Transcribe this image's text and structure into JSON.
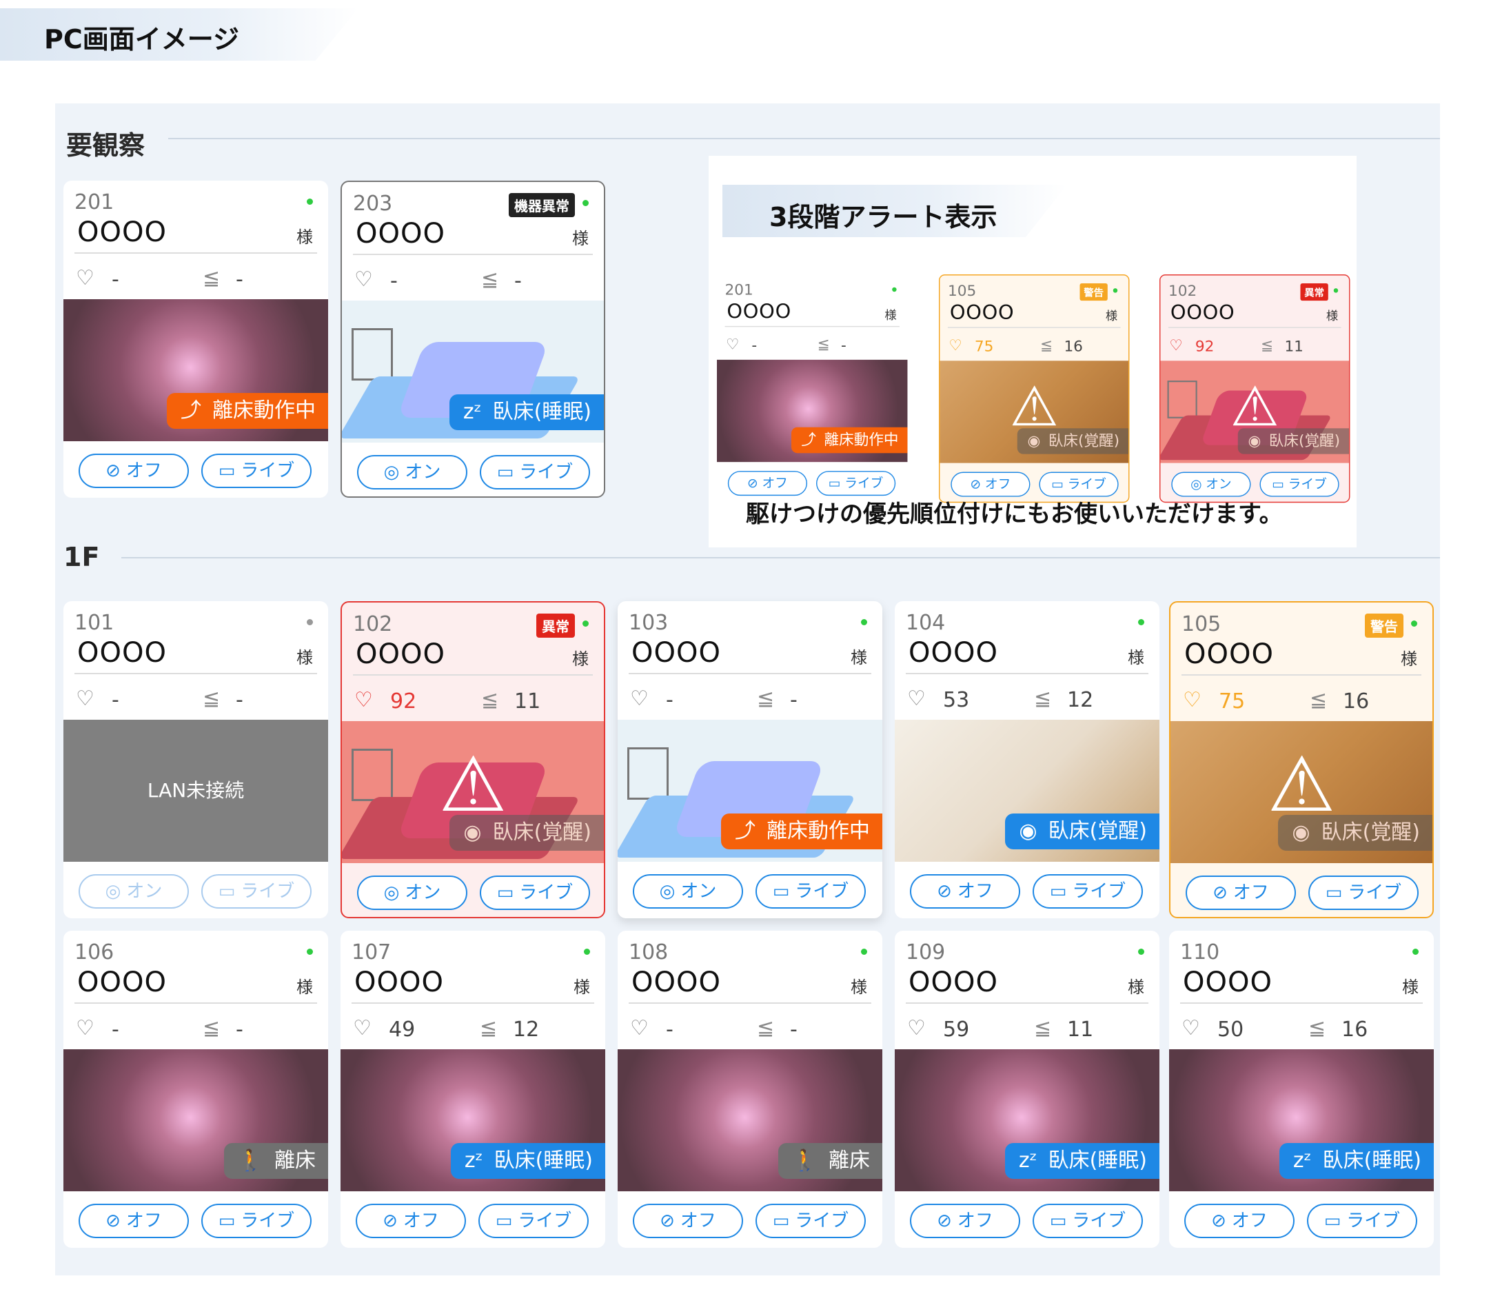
{
  "header": {
    "title": "PC画面イメージ"
  },
  "sections": {
    "watch": "要観察",
    "floor": "1F"
  },
  "common": {
    "sama": "様",
    "on": "オン",
    "off": "オフ",
    "live": "ライブ"
  },
  "inset": {
    "title": "3段階アラート表示",
    "footer": "駆けつけの優先順位付けにもお使いいただけます。"
  },
  "cards": {
    "c201": {
      "room": "201",
      "name": "OOOO",
      "heart": "-",
      "resp": "-",
      "status": "離床動作中",
      "cam": "オフ"
    },
    "c203": {
      "room": "203",
      "badge": "機器異常",
      "name": "OOOO",
      "heart": "-",
      "resp": "-",
      "status": "臥床(睡眠)",
      "cam": "オン"
    },
    "c101": {
      "room": "101",
      "name": "OOOO",
      "heart": "-",
      "resp": "-",
      "image_text": "LAN未接続",
      "cam": "オン"
    },
    "c102": {
      "room": "102",
      "badge": "異常",
      "name": "OOOO",
      "heart": "92",
      "resp": "11",
      "status": "臥床(覚醒)",
      "cam": "オン"
    },
    "c103": {
      "room": "103",
      "name": "OOOO",
      "heart": "-",
      "resp": "-",
      "status": "離床動作中",
      "cam": "オン"
    },
    "c104": {
      "room": "104",
      "name": "OOOO",
      "heart": "53",
      "resp": "12",
      "status": "臥床(覚醒)",
      "cam": "オフ"
    },
    "c105": {
      "room": "105",
      "badge": "警告",
      "name": "OOOO",
      "heart": "75",
      "resp": "16",
      "status": "臥床(覚醒)",
      "cam": "オフ"
    },
    "c106": {
      "room": "106",
      "name": "OOOO",
      "heart": "-",
      "resp": "-",
      "status": "離床",
      "cam": "オフ"
    },
    "c107": {
      "room": "107",
      "name": "OOOO",
      "heart": "49",
      "resp": "12",
      "status": "臥床(睡眠)",
      "cam": "オフ"
    },
    "c108": {
      "room": "108",
      "name": "OOOO",
      "heart": "-",
      "resp": "-",
      "status": "離床",
      "cam": "オフ"
    },
    "c109": {
      "room": "109",
      "name": "OOOO",
      "heart": "59",
      "resp": "11",
      "status": "臥床(睡眠)",
      "cam": "オフ"
    },
    "c110": {
      "room": "110",
      "name": "OOOO",
      "heart": "50",
      "resp": "16",
      "status": "臥床(睡眠)",
      "cam": "オフ"
    }
  },
  "colors": {
    "accent": "#1e88e5",
    "alert_red": "#e53935",
    "warn_orange": "#f5a623",
    "status_orange": "#f5610a"
  },
  "icons": {
    "heart": "heart-pulse-icon",
    "resp": "respiration-icon",
    "camera_off": "camera-off-icon",
    "camera_on": "camera-icon",
    "video": "video-icon",
    "sleep": "sleep-zzz-icon",
    "eye": "eye-icon",
    "person_rise": "person-rising-icon",
    "walk": "walking-icon",
    "warning": "warning-icon"
  }
}
